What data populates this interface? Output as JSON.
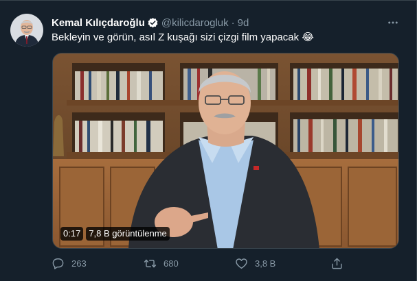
{
  "tweet": {
    "author_name": "Kemal Kılıçdaroğlu",
    "handle": "@kilicdarogluk",
    "separator": "·",
    "time": "9d",
    "text": "Bekleyin ve görün, asıl Z kuşağı sizi çizgi film yapacak 😂",
    "verified_icon": "verified-badge-icon",
    "more_icon": "more-options-icon"
  },
  "media": {
    "duration": "0:17",
    "views": "7,8 B görüntülenme"
  },
  "actions": {
    "reply_count": "263",
    "retweet_count": "680",
    "like_count": "3,8 B"
  },
  "colors": {
    "background": "#15202b",
    "secondary_text": "#8899a6",
    "border": "#38444d",
    "verified": "#1da1f2"
  }
}
